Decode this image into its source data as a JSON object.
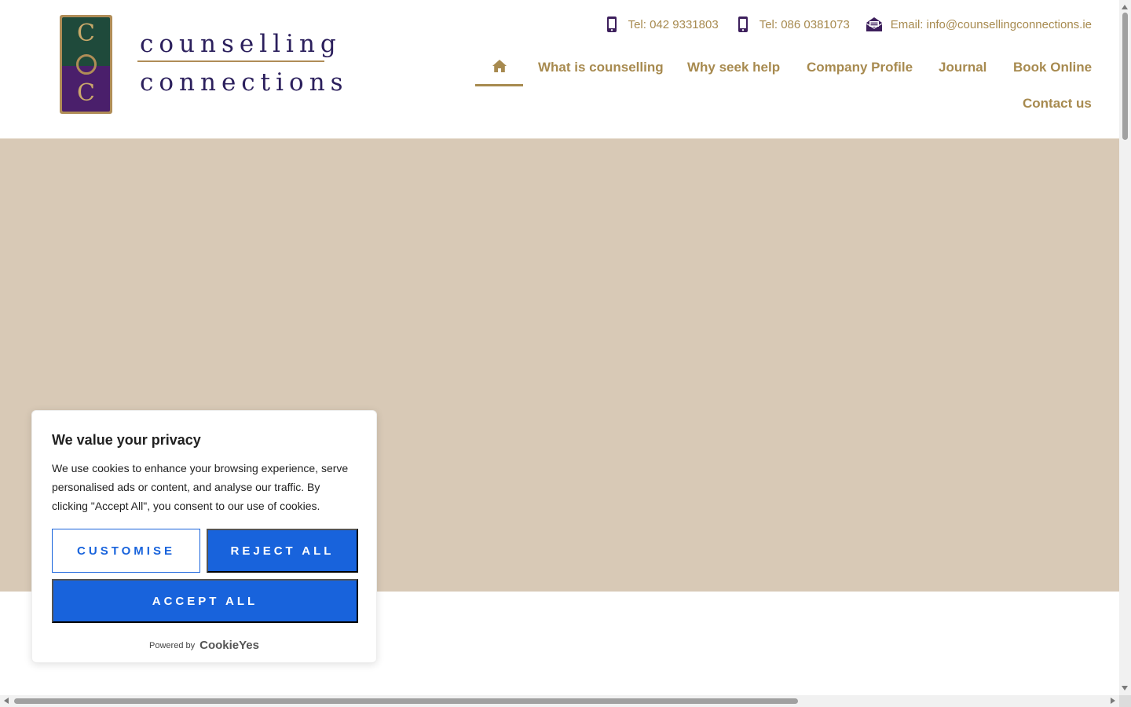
{
  "brand": {
    "logo_letter_top": "C",
    "logo_letter_bottom": "C",
    "logo_word_1": "counselling",
    "logo_word_2": "connections"
  },
  "contacts": [
    {
      "icon": "mobile-phone-icon",
      "label": "Tel: 042 9331803"
    },
    {
      "icon": "mobile-phone-icon",
      "label": "Tel: 086 0381073"
    },
    {
      "icon": "envelope-open-icon",
      "label": "Email: info@counsellingconnections.ie"
    }
  ],
  "nav": {
    "home_icon": "home-icon",
    "items": [
      {
        "label": "What is counselling"
      },
      {
        "label": "Why seek help"
      },
      {
        "label": "Company Profile"
      },
      {
        "label": "Journal"
      },
      {
        "label": "Book Online"
      },
      {
        "label": "Contact us"
      }
    ]
  },
  "cookie_banner": {
    "title": "We value your privacy",
    "text": "We use cookies to enhance your browsing experience, serve personalised ads or content, and analyse our traffic. By clicking \"Accept All\", you consent to our use of cookies.",
    "customise_label": "CUSTOMISE",
    "reject_label": "REJECT ALL",
    "accept_label": "ACCEPT ALL",
    "powered_by_label": "Powered by",
    "powered_by_brand": "CookieYes"
  },
  "colors": {
    "accent_gold": "#a78a4f",
    "brand_purple": "#2b1f5c",
    "hero_background": "#d8c9b6",
    "cookie_button_blue": "#1863dc"
  }
}
